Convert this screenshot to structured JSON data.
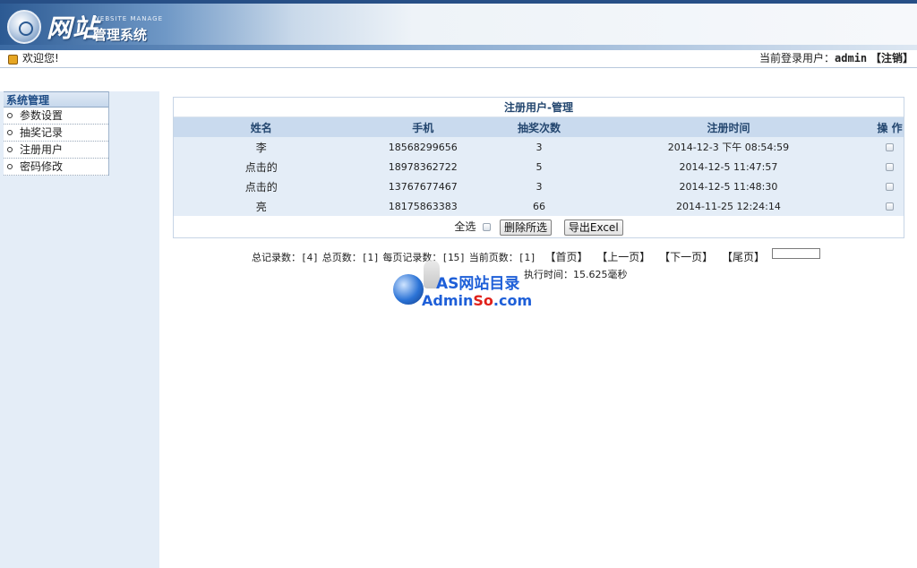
{
  "header": {
    "brand_big": "网站",
    "brand_en": "WEBSITE MANAGE",
    "brand_small": "管理系统"
  },
  "welcome": {
    "greeting": "欢迎您!",
    "login_label": "当前登录用户：",
    "username": "admin",
    "logout": "【注销】"
  },
  "sidebar": {
    "title": "系统管理",
    "items": [
      {
        "label": "参数设置"
      },
      {
        "label": "抽奖记录"
      },
      {
        "label": "注册用户"
      },
      {
        "label": "密码修改"
      }
    ]
  },
  "table": {
    "caption": "注册用户-管理",
    "columns": [
      "姓名",
      "手机",
      "抽奖次数",
      "注册时间",
      "操 作"
    ],
    "rows": [
      {
        "name": "李",
        "phone": "18568299656",
        "draws": "3",
        "time": "2014-12-3 下午 08:54:59"
      },
      {
        "name": "点击的",
        "phone": "18978362722",
        "draws": "5",
        "time": "2014-12-5 11:47:57"
      },
      {
        "name": "点击的",
        "phone": "13767677467",
        "draws": "3",
        "time": "2014-12-5 11:48:30"
      },
      {
        "name": "亮",
        "phone": "18175863383",
        "draws": "66",
        "time": "2014-11-25 12:24:14"
      }
    ],
    "select_all": "全选",
    "delete_button": "删除所选",
    "export_button": "导出Excel"
  },
  "pager": {
    "total_records": "总记录数：[4]",
    "total_pages": "总页数：[1]",
    "per_page": "每页记录数：[15]",
    "current_page": "当前页数：[1]",
    "first": "【首页】",
    "prev": "【上一页】",
    "next": "【下一页】",
    "last": "【尾页】",
    "timing": "执行时间：15.625毫秒"
  },
  "watermark": {
    "title": "AS网站目录",
    "url_a": "Admin",
    "url_b": "So",
    "url_c": ".com"
  }
}
